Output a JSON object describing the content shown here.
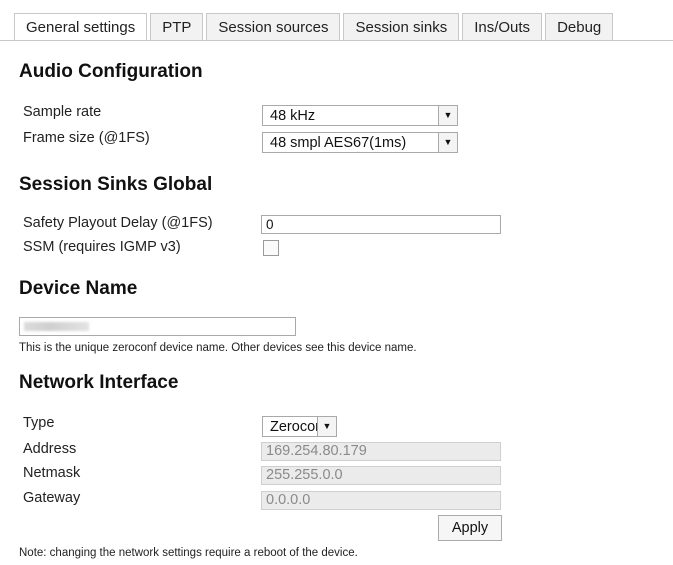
{
  "tabs": [
    "General settings",
    "PTP",
    "Session sources",
    "Session sinks",
    "Ins/Outs",
    "Debug"
  ],
  "audio": {
    "heading": "Audio Configuration",
    "sample_rate_label": "Sample rate",
    "sample_rate_value": "48 kHz",
    "frame_size_label": "Frame size (@1FS)",
    "frame_size_value": "48 smpl AES67(1ms)"
  },
  "sinks_global": {
    "heading": "Session Sinks Global",
    "safety_label": "Safety Playout Delay (@1FS)",
    "safety_value": "0",
    "ssm_label": "SSM (requires IGMP v3)",
    "ssm_checked": false
  },
  "device": {
    "heading": "Device Name",
    "name_value": "Horus_80067",
    "description": "This is the unique zeroconf device name. Other devices see this device name."
  },
  "network": {
    "heading": "Network Interface",
    "type_label": "Type",
    "type_value": "Zeroconf",
    "address_label": "Address",
    "address_value": "169.254.80.179",
    "netmask_label": "Netmask",
    "netmask_value": "255.255.0.0",
    "gateway_label": "Gateway",
    "gateway_value": "0.0.0.0",
    "apply_label": "Apply",
    "note": "Note: changing the network settings require a reboot of the device."
  },
  "icons": {
    "dropdown": "chevron-down-icon",
    "checkbox": "checkbox-unchecked"
  }
}
